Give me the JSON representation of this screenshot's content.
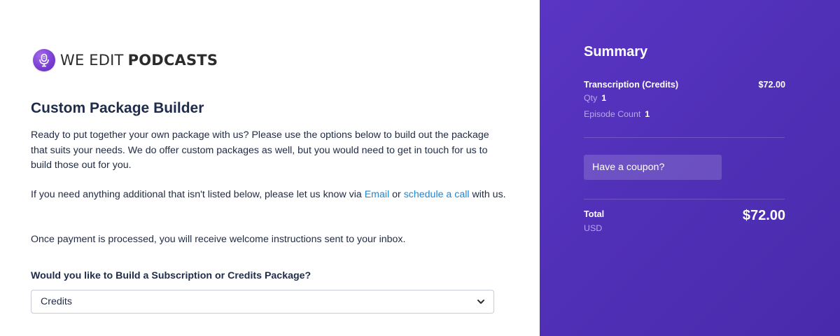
{
  "brand": {
    "logo_word1": "WE EDIT",
    "logo_word2": "PODCASTS",
    "logo_icon": "microphone-icon",
    "accent_color": "#5a35c4",
    "link_color": "#1f86d3"
  },
  "main": {
    "title": "Custom Package Builder",
    "intro": "Ready to put together your own package with us? Please use the options below to build out the package that suits your needs. We do offer custom packages as well, but you would need to get in touch for us to build those out for you.",
    "contact": {
      "prefix": "If you need anything additional that isn't listed below, please let us know via ",
      "email_link": "Email",
      "middle": " or ",
      "call_link": "schedule a call",
      "suffix": " with us."
    },
    "payment_note": "Once payment is processed, you will receive welcome instructions sent to your inbox.",
    "question": "Would you like to Build a Subscription or Credits Package?",
    "select_value": "Credits",
    "select_icon": "chevron-down-icon"
  },
  "summary": {
    "title": "Summary",
    "item_name": "Transcription (Credits)",
    "item_price": "$72.00",
    "qty_label": "Qty",
    "qty_value": "1",
    "episode_label": "Episode Count",
    "episode_value": "1",
    "coupon_label": "Have a coupon?",
    "total_label": "Total",
    "currency": "USD",
    "total_amount": "$72.00"
  }
}
